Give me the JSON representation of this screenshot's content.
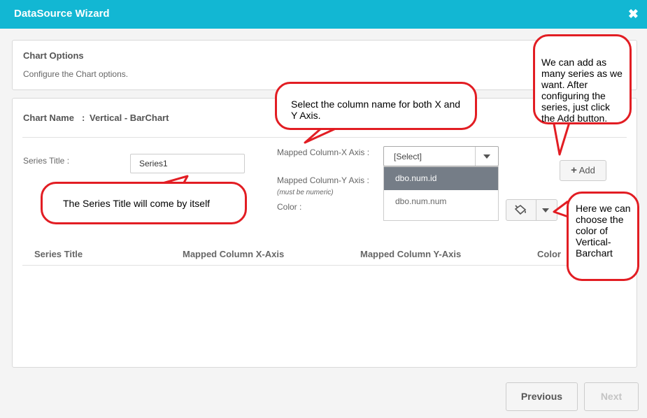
{
  "window": {
    "title": "DataSource Wizard",
    "close_icon": "✖"
  },
  "chart_options": {
    "heading": "Chart Options",
    "description": "Configure the Chart options."
  },
  "chart_name": {
    "label": "Chart Name",
    "separator": ":",
    "value": "Vertical - BarChart"
  },
  "series_title": {
    "label": "Series Title :",
    "value": "Series1"
  },
  "mapped_x": {
    "label": "Mapped Column-X Axis :",
    "selected": "[Select]",
    "options": [
      "dbo.num.id",
      "dbo.num.num"
    ]
  },
  "mapped_y": {
    "label": "Mapped Column-Y Axis :",
    "note": "(must be numeric)"
  },
  "color": {
    "label": "Color :",
    "icon": "paint-bucket-icon"
  },
  "add_button": {
    "label": "Add",
    "icon": "+"
  },
  "table": {
    "headers": [
      "Series Title",
      "Mapped Column X-Axis",
      "Mapped Column Y-Axis",
      "Color"
    ]
  },
  "footer": {
    "previous": "Previous",
    "next": "Next"
  },
  "annotations": {
    "add_series": "We can add as many series as we want. After configuring the series, just click the Add button.",
    "select_columns": "Select the column name for both X and Y Axis.",
    "series_title_auto": "The Series Title will come by itself",
    "choose_color": "Here we can choose the color of Vertical-Barchart"
  },
  "colors": {
    "header": "#12b7d3",
    "callout_border": "#e21d23",
    "selected_option": "#757d87"
  }
}
